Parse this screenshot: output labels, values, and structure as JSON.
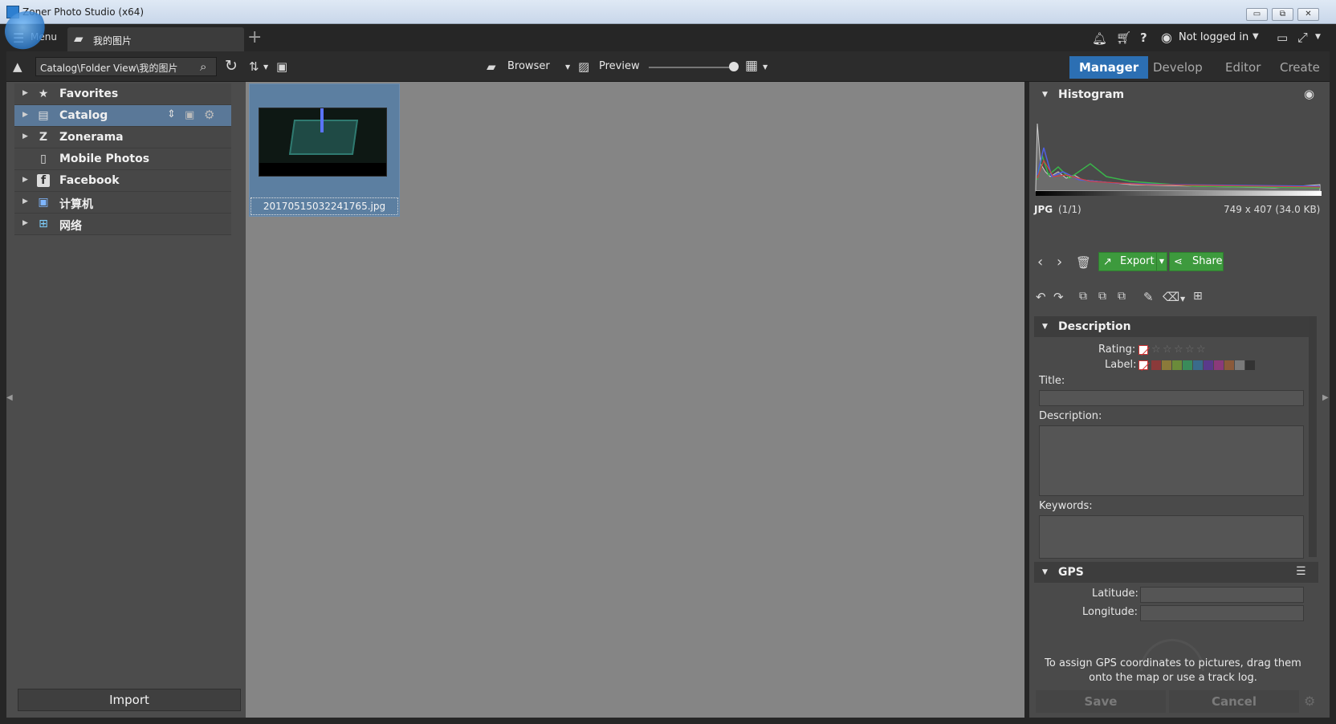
{
  "window": {
    "title": "Zoner Photo Studio (x64)",
    "minimize": "▭",
    "restore": "⧉",
    "close": "✕"
  },
  "topbar": {
    "menu_label": "Menu",
    "folder_tab_label": "我的图片",
    "add_tab": "+",
    "user_label": "Not logged in",
    "icons": [
      "bell-icon",
      "cart-icon",
      "help-icon",
      "user-icon",
      "monitor-icon",
      "fullscreen-icon"
    ]
  },
  "toolbar": {
    "path": "Catalog\\Folder View\\我的图片",
    "browser_label": "Browser",
    "preview_label": "Preview",
    "zoom_slider": 0.98,
    "modes": [
      "Manager",
      "Develop",
      "Editor",
      "Create"
    ],
    "active_mode": "Manager"
  },
  "nav": {
    "items": [
      {
        "label": "Favorites",
        "icon": "star-icon",
        "glyph": "★"
      },
      {
        "label": "Catalog",
        "icon": "catalog-icon",
        "glyph": "▤"
      },
      {
        "label": "Zonerama",
        "icon": "zonerama-icon",
        "glyph": "Z"
      },
      {
        "label": "Mobile Photos",
        "icon": "phone-icon",
        "glyph": "▯"
      },
      {
        "label": "Facebook",
        "icon": "facebook-icon",
        "glyph": "f"
      },
      {
        "label": "计算机",
        "icon": "computer-icon",
        "glyph": "▣"
      },
      {
        "label": "网络",
        "icon": "network-icon",
        "glyph": "⊞"
      }
    ],
    "import_label": "Import"
  },
  "browser": {
    "thumb_filename": "20170515032241765.jpg"
  },
  "histogram": {
    "title": "Histogram",
    "format": "JPG",
    "index": "(1/1)",
    "info": "749 x 407 (34.0 KB)"
  },
  "actions": {
    "export_label": "Export",
    "share_label": "Share",
    "accent": "#3d9a3d"
  },
  "description": {
    "title": "Description",
    "rating_label": "Rating:",
    "label_label": "Label:",
    "title_label": "Title:",
    "description_label": "Description:",
    "keywords_label": "Keywords:",
    "rating_value": 0,
    "label_colors": [
      "#8b3a3a",
      "#8b7a3a",
      "#6b8b3a",
      "#3a8b5a",
      "#3a6b8b",
      "#5a3a8b",
      "#8b3a7a",
      "#8b5a3a",
      "#7a7a7a",
      "#333333"
    ]
  },
  "gps": {
    "title": "GPS",
    "latitude_label": "Latitude:",
    "longitude_label": "Longitude:",
    "hint": "To assign GPS coordinates to pictures, drag them onto the map or use a track log."
  },
  "footer": {
    "save_label": "Save",
    "cancel_label": "Cancel"
  }
}
